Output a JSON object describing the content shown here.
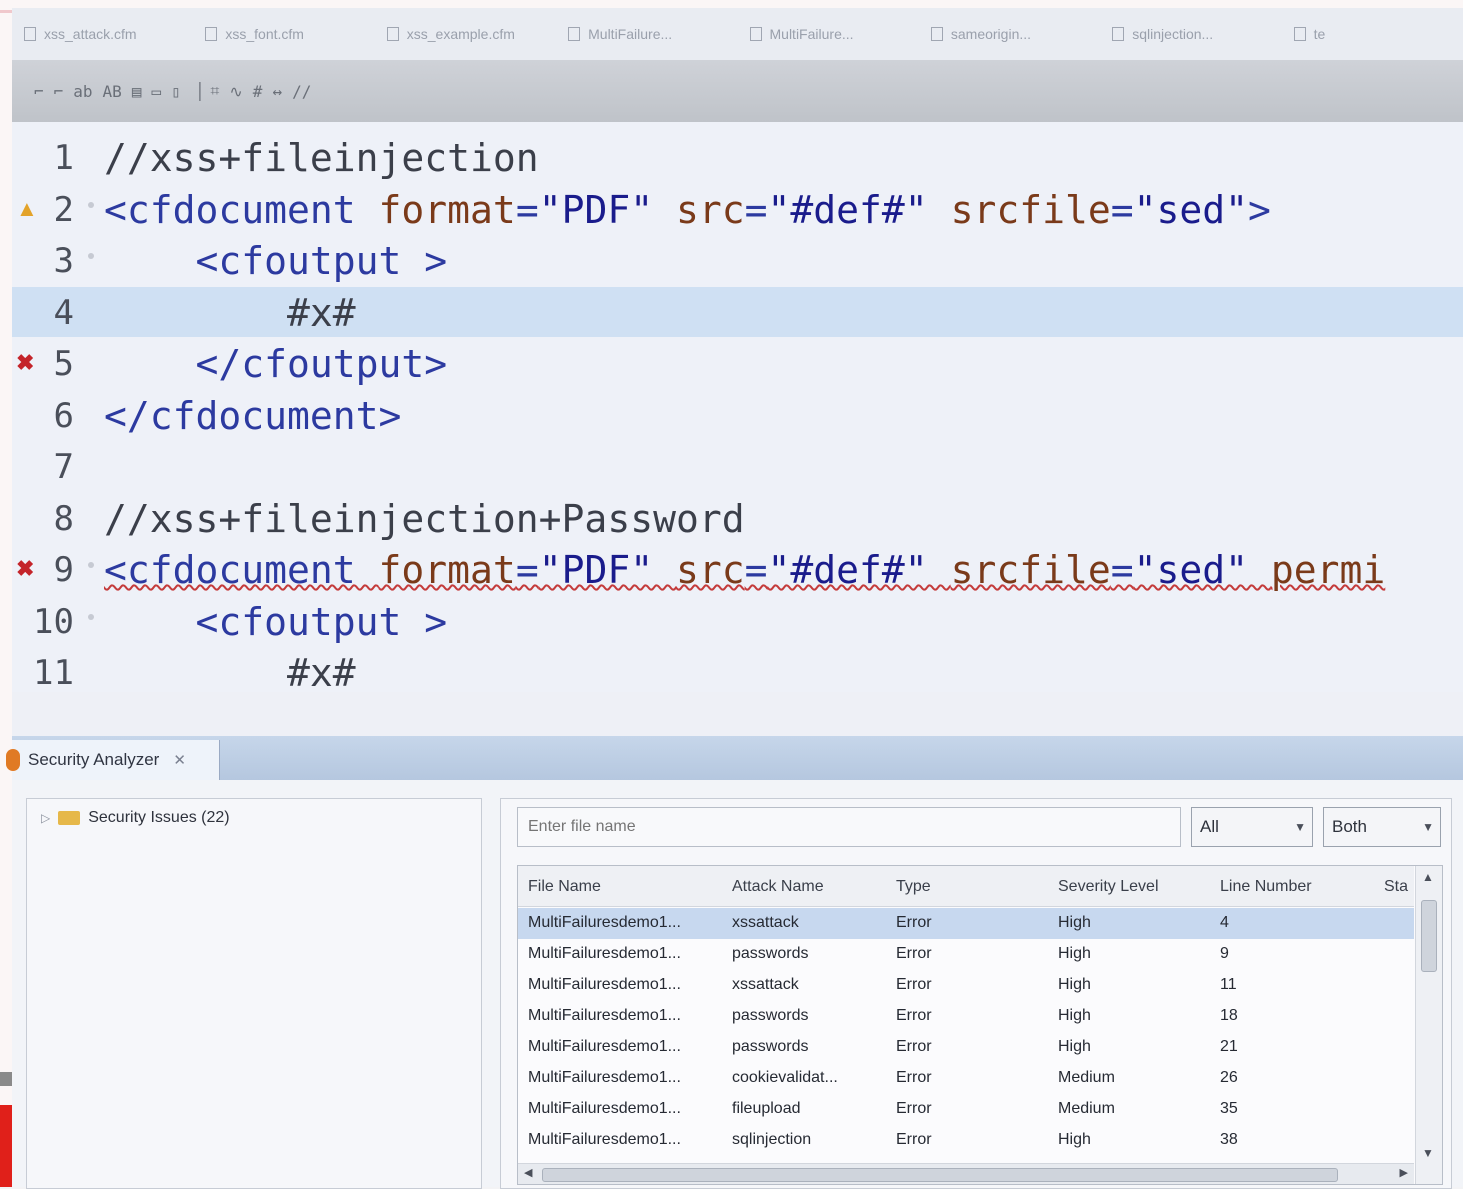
{
  "editor_tabs": [
    {
      "label": "xss_attack.cfm"
    },
    {
      "label": "xss_font.cfm"
    },
    {
      "label": "xss_example.cfm"
    },
    {
      "label": "MultiFailure..."
    },
    {
      "label": "MultiFailure..."
    },
    {
      "label": "sameorigin..."
    },
    {
      "label": "sqlinjection..."
    },
    {
      "label": "te"
    }
  ],
  "toolbar": {
    "items": [
      "⌐",
      "⌐",
      "ab",
      "AB",
      "▤",
      "▭",
      "▯",
      "▕",
      "⌗",
      "∿",
      "#",
      "↔",
      "//"
    ]
  },
  "code_lines": [
    {
      "num": "1",
      "marker": "",
      "fold": false,
      "segments": [
        {
          "cls": "comment",
          "text": "//xss+fileinjection"
        }
      ]
    },
    {
      "num": "2",
      "marker": "warning",
      "fold": true,
      "segments": [
        {
          "cls": "tag",
          "text": "<cfdocument "
        },
        {
          "cls": "attr",
          "text": "format"
        },
        {
          "cls": "tag",
          "text": "="
        },
        {
          "cls": "str",
          "text": "\"PDF\" "
        },
        {
          "cls": "attr",
          "text": "src"
        },
        {
          "cls": "tag",
          "text": "="
        },
        {
          "cls": "str",
          "text": "\"#def#\" "
        },
        {
          "cls": "attr",
          "text": "srcfile"
        },
        {
          "cls": "tag",
          "text": "="
        },
        {
          "cls": "str",
          "text": "\"sed\""
        },
        {
          "cls": "tag",
          "text": ">"
        }
      ]
    },
    {
      "num": "3",
      "marker": "",
      "fold": true,
      "segments": [
        {
          "cls": "tag",
          "text": "    <cfoutput >"
        }
      ]
    },
    {
      "num": "4",
      "marker": "",
      "fold": false,
      "highlight": true,
      "segments": [
        {
          "cls": "comment",
          "text": "        #x#"
        }
      ]
    },
    {
      "num": "5",
      "marker": "error",
      "fold": false,
      "segments": [
        {
          "cls": "tag",
          "text": "    </cfoutput>"
        }
      ]
    },
    {
      "num": "6",
      "marker": "",
      "fold": false,
      "segments": [
        {
          "cls": "tag",
          "text": "</cfdocument>"
        }
      ]
    },
    {
      "num": "7",
      "marker": "",
      "fold": false,
      "segments": [
        {
          "cls": "comment",
          "text": ""
        }
      ]
    },
    {
      "num": "8",
      "marker": "",
      "fold": false,
      "segments": [
        {
          "cls": "comment",
          "text": "//xss+fileinjection+Password"
        }
      ]
    },
    {
      "num": "9",
      "marker": "error",
      "fold": true,
      "squiggle": true,
      "segments": [
        {
          "cls": "tag",
          "text": "<cfdocument "
        },
        {
          "cls": "attr",
          "text": "format"
        },
        {
          "cls": "tag",
          "text": "="
        },
        {
          "cls": "str",
          "text": "\"PDF\" "
        },
        {
          "cls": "attr",
          "text": "src"
        },
        {
          "cls": "tag",
          "text": "="
        },
        {
          "cls": "str",
          "text": "\"#def#\" "
        },
        {
          "cls": "attr",
          "text": "srcfile"
        },
        {
          "cls": "tag",
          "text": "="
        },
        {
          "cls": "str",
          "text": "\"sed\" "
        },
        {
          "cls": "attr",
          "text": "permi"
        }
      ]
    },
    {
      "num": "10",
      "marker": "",
      "fold": true,
      "segments": [
        {
          "cls": "tag",
          "text": "    <cfoutput >"
        }
      ]
    },
    {
      "num": "11",
      "marker": "",
      "fold": false,
      "segments": [
        {
          "cls": "comment",
          "text": "        #x#"
        }
      ]
    }
  ],
  "view": {
    "tab_label": "Security Analyzer",
    "close_glyph": "✕",
    "tree_root": "Security Issues (22)",
    "filter": {
      "placeholder": "Enter file name",
      "value": ""
    },
    "scope_select": "All",
    "severity_select": "Both",
    "columns": [
      "File Name",
      "Attack Name",
      "Type",
      "Severity Level",
      "Line Number",
      "Sta"
    ],
    "rows": [
      [
        "MultiFailuresdemo1...",
        "xssattack",
        "Error",
        "High",
        "4"
      ],
      [
        "MultiFailuresdemo1...",
        "passwords",
        "Error",
        "High",
        "9"
      ],
      [
        "MultiFailuresdemo1...",
        "xssattack",
        "Error",
        "High",
        "11"
      ],
      [
        "MultiFailuresdemo1...",
        "passwords",
        "Error",
        "High",
        "18"
      ],
      [
        "MultiFailuresdemo1...",
        "passwords",
        "Error",
        "High",
        "21"
      ],
      [
        "MultiFailuresdemo1...",
        "cookievalidat...",
        "Error",
        "Medium",
        "26"
      ],
      [
        "MultiFailuresdemo1...",
        "fileupload",
        "Error",
        "Medium",
        "35"
      ],
      [
        "MultiFailuresdemo1...",
        "sqlinjection",
        "Error",
        "High",
        "38"
      ]
    ]
  },
  "colors": {
    "highlight_line": "#cfe0f3",
    "selected_row": "#c7d8ef",
    "error_marker": "#c4242a",
    "warning_marker": "#e3a32a",
    "accent_red": "#e0201a"
  }
}
